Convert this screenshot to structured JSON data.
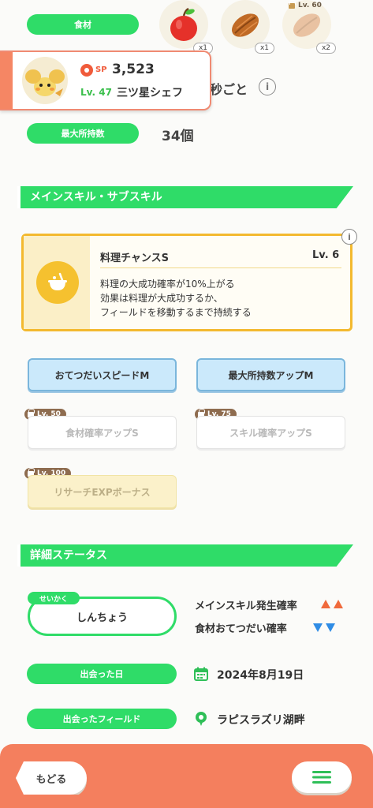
{
  "ingredients": {
    "label": "食材",
    "items": [
      {
        "name": "apple",
        "qty": "x1",
        "locked": false
      },
      {
        "name": "cacao",
        "qty": "x1",
        "locked": false
      },
      {
        "name": "cacao",
        "qty": "x2",
        "locked": true,
        "unlock_level": "Lv. 60"
      }
    ]
  },
  "pokemon": {
    "sp_label": "SP",
    "sp_value": "3,523",
    "level": "Lv. 47",
    "title": "三ツ星シェフ"
  },
  "help_interval": {
    "text": "秒ごと"
  },
  "max_carry": {
    "label": "最大所持数",
    "value": "34個"
  },
  "skills_section": {
    "title": "メインスキル・サブスキル",
    "main_skill": {
      "name": "料理チャンスS",
      "level": "Lv. 6",
      "desc1": "料理の大成功確率が10%上がる",
      "desc2": "効果は料理が大成功するか、",
      "desc3": "フィールドを移動するまで持続する"
    },
    "sub_skills": [
      {
        "label": "おてつだいスピードM",
        "state": "active"
      },
      {
        "label": "最大所持数アップM",
        "state": "active"
      },
      {
        "label": "食材確率アップS",
        "state": "locked",
        "unlock": "Lv. 50"
      },
      {
        "label": "スキル確率アップS",
        "state": "locked",
        "unlock": "Lv. 75"
      },
      {
        "label": "リサーチEXPボーナス",
        "state": "locked-gold",
        "unlock": "Lv. 100"
      }
    ]
  },
  "details_section": {
    "title": "詳細ステータス",
    "nature_tag": "せいかく",
    "nature": "しんちょう",
    "effects": [
      {
        "label": "メインスキル発生確率",
        "direction": "up",
        "color": "#f06a3c"
      },
      {
        "label": "食材おてつだい確率",
        "direction": "down",
        "color": "#2f8ce5"
      }
    ],
    "met_date_label": "出会った日",
    "met_date": "2024年8月19日",
    "met_field_label": "出会ったフィールド",
    "met_field": "ラピスラズリ湖畔"
  },
  "footer": {
    "back_label": "もどる",
    "menu_icon": "hamburger-menu-icon"
  },
  "colors": {
    "accent_green": "#2fdc68",
    "footer_orange": "#f47f5e",
    "skill_blue": "#cbe9fb",
    "skill_gold": "#f3b92f"
  }
}
